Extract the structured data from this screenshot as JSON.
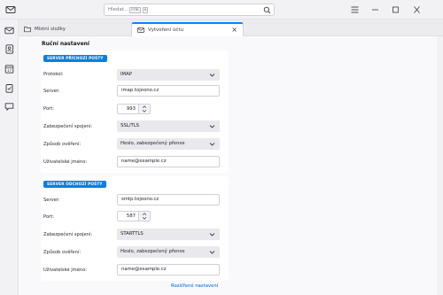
{
  "titlebar": {
    "search_placeholder": "Hledat...",
    "kbd_ctrl": "CTRL",
    "kbd_k": "K",
    "app_icon": "mail-icon",
    "buttons": [
      "menu-icon",
      "minimize-icon",
      "maximize-icon",
      "close-icon"
    ]
  },
  "spaces": {
    "items": [
      "mail-icon",
      "address-book-icon",
      "calendar-icon",
      "tasks-icon",
      "chat-icon"
    ]
  },
  "tabs": [
    {
      "label": "Místní složky",
      "icon": "folder-icon"
    },
    {
      "label": "Vytvoření účtu",
      "icon": "mail-icon"
    }
  ],
  "page": {
    "heading": "Ruční nastavení"
  },
  "incoming": {
    "badge": "SERVER PŘÍCHOZÍ POŠTY",
    "protocol_label": "Protokol:",
    "protocol_value": "IMAP",
    "server_label": "Server:",
    "server_value": "imap.tojeono.cz",
    "port_label": "Port:",
    "port_value": "993",
    "security_label": "Zabezpečení spojení:",
    "security_value": "SSL/TLS",
    "auth_label": "Způsob ověření:",
    "auth_value": "Heslo, zabezpečený přenos",
    "username_label": "Uživatelské jméno:",
    "username_value": "name@example.cz"
  },
  "outgoing": {
    "badge": "SERVER ODCHOZÍ POŠTY",
    "server_label": "Server:",
    "server_value": "smtp.tojeono.cz",
    "port_label": "Port:",
    "port_value": "587",
    "security_label": "Zabezpečení spojení:",
    "security_value": "STARTTLS",
    "auth_label": "Způsob ověření:",
    "auth_value": "Heslo, zabezpečený přenos",
    "username_label": "Uživatelské jméno:",
    "username_value": "name@example.cz"
  },
  "footer": {
    "advanced_link": "Rozšířené nastavení"
  },
  "colors": {
    "accent": "#0a7fe0",
    "link": "#0061e0",
    "active_tab_border": "#0a84ff"
  }
}
